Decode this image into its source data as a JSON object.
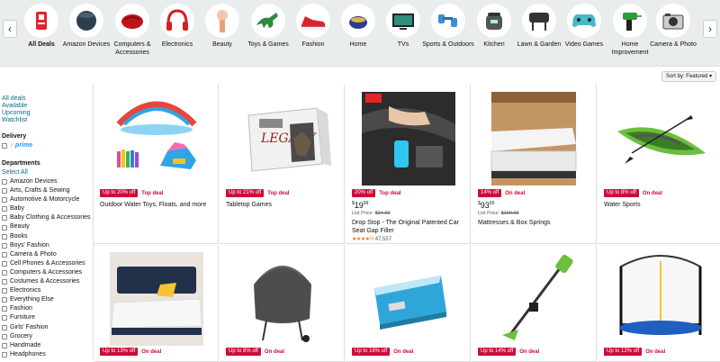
{
  "nav": {
    "prev": "‹",
    "next": "›"
  },
  "categories": [
    {
      "label": "All Deals",
      "icon": "all-deals-icon"
    },
    {
      "label": "Amazon Devices",
      "icon": "smart-speaker-icon"
    },
    {
      "label": "Computers & Accessories",
      "icon": "mouse-icon"
    },
    {
      "label": "Electronics",
      "icon": "headphones-icon"
    },
    {
      "label": "Beauty",
      "icon": "makeup-brush-icon"
    },
    {
      "label": "Toys & Games",
      "icon": "dinosaur-toy-icon"
    },
    {
      "label": "Fashion",
      "icon": "sneaker-icon"
    },
    {
      "label": "Home",
      "icon": "candle-icon"
    },
    {
      "label": "TVs",
      "icon": "tv-icon"
    },
    {
      "label": "Sports & Outdoors",
      "icon": "dumbbells-icon"
    },
    {
      "label": "Kitchen",
      "icon": "pressure-cooker-icon"
    },
    {
      "label": "Lawn & Garden",
      "icon": "grill-icon"
    },
    {
      "label": "Video Games",
      "icon": "game-controller-icon"
    },
    {
      "label": "Home Improvement",
      "icon": "drill-icon"
    },
    {
      "label": "Camera & Photo",
      "icon": "camera-icon"
    }
  ],
  "sort": {
    "label": "Sort by:",
    "value": "Featured"
  },
  "sidebar": {
    "deal_links": [
      "All deals",
      "Available",
      "Upcoming",
      "Watchlist"
    ],
    "delivery_heading": "Delivery",
    "prime_label": "prime",
    "departments_heading": "Departments",
    "select_all": "Select All",
    "departments": [
      "Amazon Devices",
      "Arts, Crafts & Sewing",
      "Automotive & Motorcycle",
      "Baby",
      "Baby Clothing & Accessories",
      "Beauty",
      "Books",
      "Boys' Fashion",
      "Camera & Photo",
      "Cell Phones & Accessories",
      "Computers & Accessories",
      "Costumes & Accessories",
      "Electronics",
      "Everything Else",
      "Fashion",
      "Furniture",
      "Girls' Fashion",
      "Grocery",
      "Handmade",
      "Headphones"
    ]
  },
  "deals": [
    {
      "badge": "Up to 20% off",
      "deal": "Top deal",
      "title": "Outdoor Water Toys, Floats, and more",
      "image": "water-toys-image"
    },
    {
      "badge": "Up to 21% off",
      "deal": "Top deal",
      "title": "Tabletop Games",
      "image": "board-game-image"
    },
    {
      "badge": "20% off",
      "deal": "Top deal",
      "price_whole": "19",
      "price_frac": "99",
      "list_label": "List Price:",
      "list_price": "$24.99",
      "title": "Drop Stop - The Original Patented Car Seat Gap Filler",
      "stars": "★★★★½",
      "reviews": "47,557",
      "image": "car-seat-gap-image"
    },
    {
      "badge": "14% off",
      "deal": "On deal",
      "price_whole": "93",
      "price_frac": "50",
      "list_label": "List Price:",
      "list_price": "$109.99",
      "title": "Mattresses & Box Springs",
      "image": "mattress-image"
    },
    {
      "badge": "Up to 8% off",
      "deal": "On deal",
      "title": "Water Sports",
      "image": "kayak-image"
    },
    {
      "badge": "Up to 13% off",
      "deal": "On deal",
      "image": "bed-image"
    },
    {
      "badge": "Up to 8% off",
      "deal": "On deal",
      "image": "grill-cover-image"
    },
    {
      "badge": "Up to 16% off",
      "deal": "On deal",
      "image": "cooler-bag-image"
    },
    {
      "badge": "Up to 14% off",
      "deal": "On deal",
      "image": "string-trimmer-image"
    },
    {
      "badge": "Up to 12% off",
      "deal": "On deal",
      "image": "trampoline-image"
    }
  ],
  "colors": {
    "deal_red": "#cc0c39",
    "link_teal": "#007185",
    "prime_blue": "#1a98ff",
    "star_orange": "#de7921",
    "bar_gray": "#eaeded"
  }
}
